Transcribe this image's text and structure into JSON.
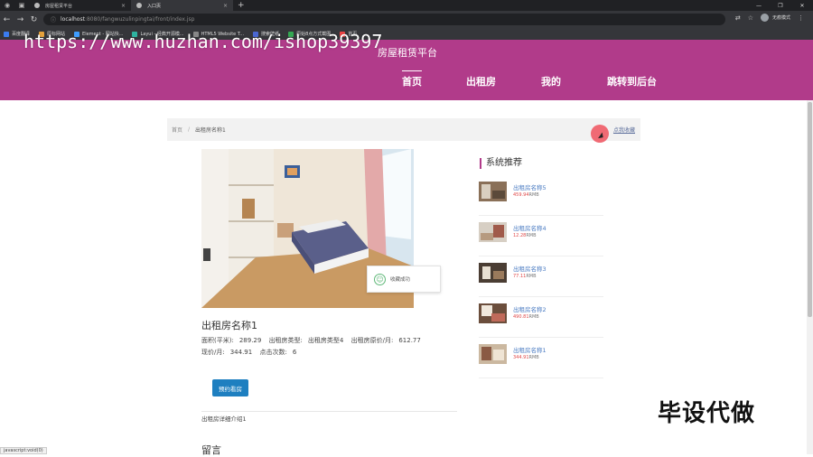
{
  "browser": {
    "tabs": [
      {
        "label": "",
        "icon": "app-icon"
      },
      {
        "label": "房屋租赁平台"
      },
      {
        "label": "入口页"
      }
    ],
    "new_tab": "+",
    "url_host": "localhost",
    "url_path": ":8080/fangwuzulinpingtai/front/index.jsp",
    "profile_label": "无痕模式",
    "bookmarks": [
      "百度翻译",
      "原标网站",
      "Element - 网站快...",
      "Layui - 经典开源模...",
      "HTML5 Website T...",
      "搜索壁纸",
      "原始8点方式截图",
      "首页"
    ]
  },
  "header": {
    "site_title": "房屋租赁平台",
    "nav": [
      "首页",
      "出租房",
      "我的",
      "跳转到后台"
    ],
    "active_nav": "首页"
  },
  "overlay_watermark": "https://www.huzhan.com/ishop39397",
  "breadcrumb": {
    "home": "首页",
    "separator": "/",
    "current": "出租房名称1",
    "favorite_label": "点我收藏"
  },
  "toast": {
    "text": "收藏成功"
  },
  "house": {
    "name": "出租房名称1",
    "area_label": "面积(平米):",
    "area": "289.29",
    "type_label": "出租房类型:",
    "type": "出租房类型4",
    "orig_price_label": "出租房原价/月:",
    "orig_price": "612.77",
    "price_label": "现价/月:",
    "price": "344.91",
    "clicks_label": "点击次数:",
    "clicks": "6",
    "book_button": "预约看房",
    "detail": "出租房详细介绍1"
  },
  "message_title": "留言",
  "recommend": {
    "title": "系统推荐",
    "items": [
      {
        "name": "出租房名称5",
        "price": "459.94",
        "unit": "RMB"
      },
      {
        "name": "出租房名称4",
        "price": "12.28",
        "unit": "RMB"
      },
      {
        "name": "出租房名称3",
        "price": "77.11",
        "unit": "RMB"
      },
      {
        "name": "出租房名称2",
        "price": "490.81",
        "unit": "RMB"
      },
      {
        "name": "出租房名称1",
        "price": "344.91",
        "unit": "RMB"
      }
    ]
  },
  "promo_text": "毕设代做",
  "status_bar": "javascript:void(0)",
  "colors": {
    "header": "#b13b8a",
    "link": "#4a7bc2",
    "price": "#e04848",
    "button": "#1e7fc0"
  }
}
